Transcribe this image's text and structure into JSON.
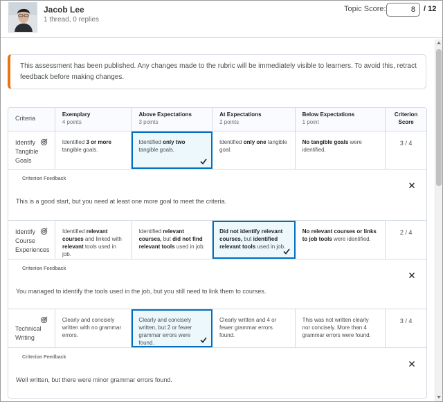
{
  "header": {
    "name": "Jacob Lee",
    "subtitle": "1 thread, 0 replies",
    "score_label": "Topic Score:",
    "score_value": "8",
    "score_total": "/ 12"
  },
  "alert": {
    "text": "This assessment has been published. Any changes made to the rubric will be immediately visible to learners. To avoid this, retract feedback before making changes."
  },
  "rubric": {
    "criteria_header": "Criteria",
    "score_header": "Criterion Score",
    "levels": [
      {
        "name": "Exemplary",
        "points": "4 points"
      },
      {
        "name": "Above Expectations",
        "points": "3 points"
      },
      {
        "name": "At Expectations",
        "points": "2 points"
      },
      {
        "name": "Below Expectations",
        "points": "1 point"
      }
    ],
    "feedback_title": "Criterion Feedback",
    "rows": [
      {
        "criterion": "Identify Tangible Goals",
        "score": "3 / 4",
        "selected_level": 1,
        "cells": [
          [
            "Identified ",
            "3 or more",
            " tangible goals."
          ],
          [
            "Identified ",
            "only two",
            " tangible goals."
          ],
          [
            "Identified ",
            "only one",
            " tangible goal."
          ],
          [
            "",
            "No tangible goals",
            " were identified."
          ]
        ],
        "feedback": "This is a good start, but you need at least one more goal to meet the criteria."
      },
      {
        "criterion": "Identify Course Experiences",
        "score": "2 / 4",
        "selected_level": 2,
        "cells": [
          [
            "Identified ",
            "relevant courses",
            " and linked with ",
            "relevant",
            " tools used in job."
          ],
          [
            "Identified ",
            "relevant courses,",
            " but ",
            "did not find relevant tools",
            " used in job."
          ],
          [
            "",
            "Did not identify relevant courses,",
            " but ",
            "identified relevant tools",
            " used in job."
          ],
          [
            "",
            "No relevant courses or links to job tools",
            " were identified."
          ]
        ],
        "feedback": "You managed to identify the tools used in the job, but you still need to link them to courses."
      },
      {
        "criterion": "Technical Writing",
        "score": "3 / 4",
        "selected_level": 1,
        "cells": [
          [
            "Clearly and concisely written with no grammar errors."
          ],
          [
            "Clearly and concisely written, but 2 or fewer grammar errors were found."
          ],
          [
            "Clearly written and 4 or fewer grammar errors found."
          ],
          [
            "This was not written clearly nor concisely. More than 4 grammar errors were found."
          ]
        ],
        "feedback": "Well written, but there were minor grammar errors found."
      }
    ]
  },
  "icons": {
    "criterion_icon": "rubric-target-icon",
    "check": "checkmark-icon",
    "close": "close-icon"
  },
  "colors": {
    "alert_accent": "#e87511",
    "selected_border": "#006fbf",
    "selected_bg": "#edf8fd"
  }
}
